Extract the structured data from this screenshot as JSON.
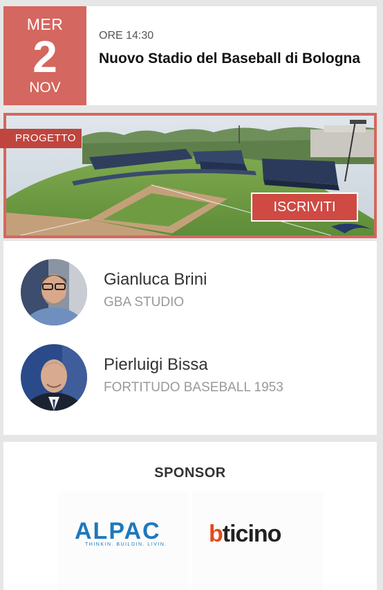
{
  "event": {
    "day_of_week": "MER",
    "day": "2",
    "month": "NOV",
    "time": "ORE 14:30",
    "title": "Nuovo Stadio del Baseball di Bologna"
  },
  "banner": {
    "tag": "PROGETTO",
    "cta": "ISCRIVITI"
  },
  "speakers": [
    {
      "name": "Gianluca Brini",
      "org": "GBA STUDIO"
    },
    {
      "name": "Pierluigi Bissa",
      "org": "FORTITUDO BASEBALL 1953"
    }
  ],
  "sponsor": {
    "title": "SPONSOR",
    "logos": [
      {
        "name": "ALPAC",
        "tagline": "THINKIN. BUILDIN. LIVIN."
      },
      {
        "name_b": "b",
        "name_rest": "ticino"
      }
    ]
  },
  "colors": {
    "accent": "#d4675f",
    "cta": "#cf4a43",
    "alpac_blue": "#1e78bd",
    "bticino_orange": "#e24b1a"
  }
}
